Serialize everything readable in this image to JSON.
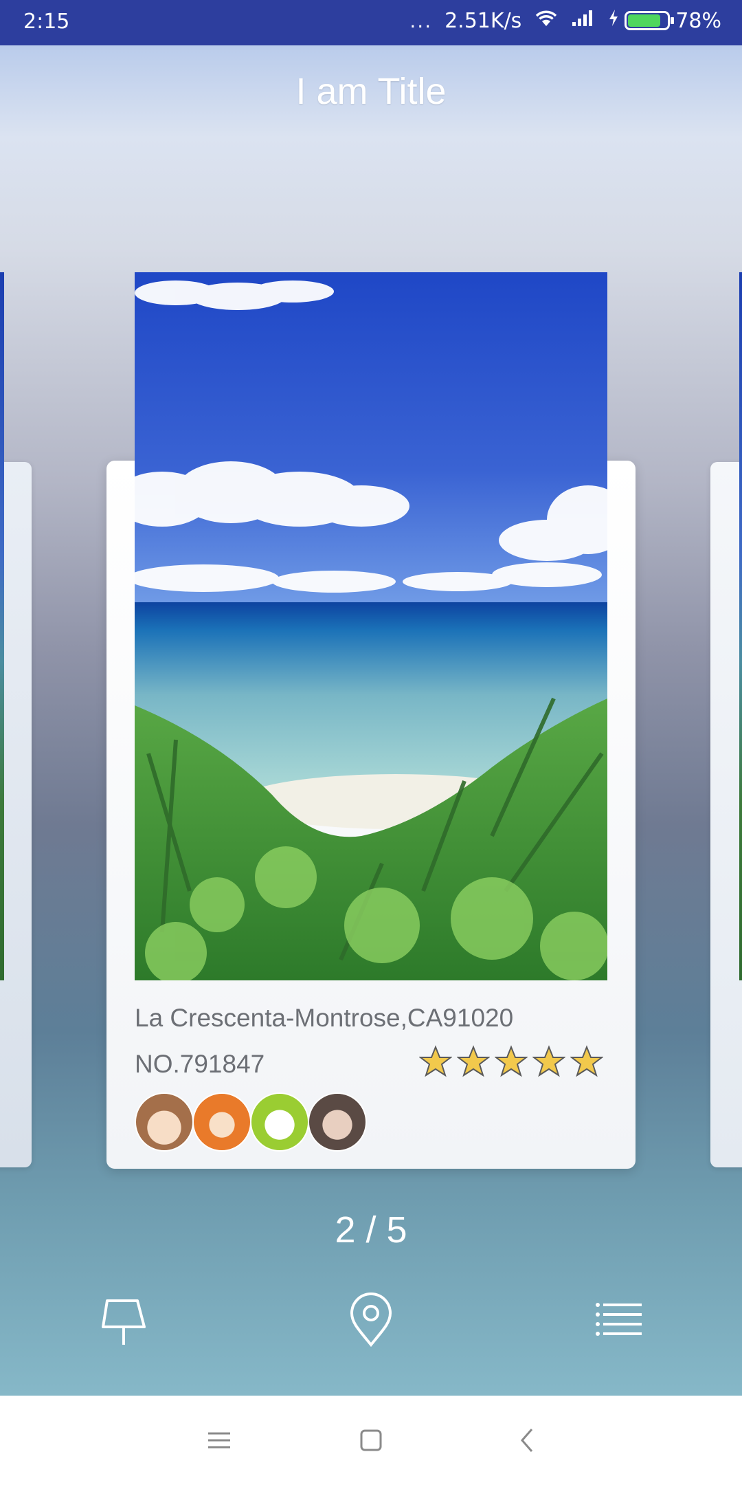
{
  "status_bar": {
    "time": "2:15",
    "dots": "...",
    "network_speed": "2.51K/s",
    "battery_percent": "78%",
    "battery_level": 0.78,
    "icons": [
      "wifi-icon",
      "signal-icon",
      "charging-icon",
      "battery-icon"
    ]
  },
  "header": {
    "title": "I am Title"
  },
  "card": {
    "address": "La Crescenta-Montrose,CA91020",
    "number": "NO.791847",
    "rating": 5,
    "rating_max": 5,
    "avatars": [
      "avatar-girl-brown-hair",
      "avatar-girl-orange-hair",
      "avatar-rabbit",
      "avatar-woman-glasses"
    ]
  },
  "pager": {
    "indicator": "2 / 5"
  },
  "actions": [
    {
      "name": "pushpin-icon"
    },
    {
      "name": "location-pin-icon"
    },
    {
      "name": "list-icon"
    }
  ],
  "nav": {
    "icons": [
      "menu-icon",
      "home-icon",
      "back-icon"
    ]
  },
  "colors": {
    "status_bar_bg": "#2d3e9e",
    "star_fill": "#f2c94c",
    "text_gray": "#6c6f75"
  }
}
